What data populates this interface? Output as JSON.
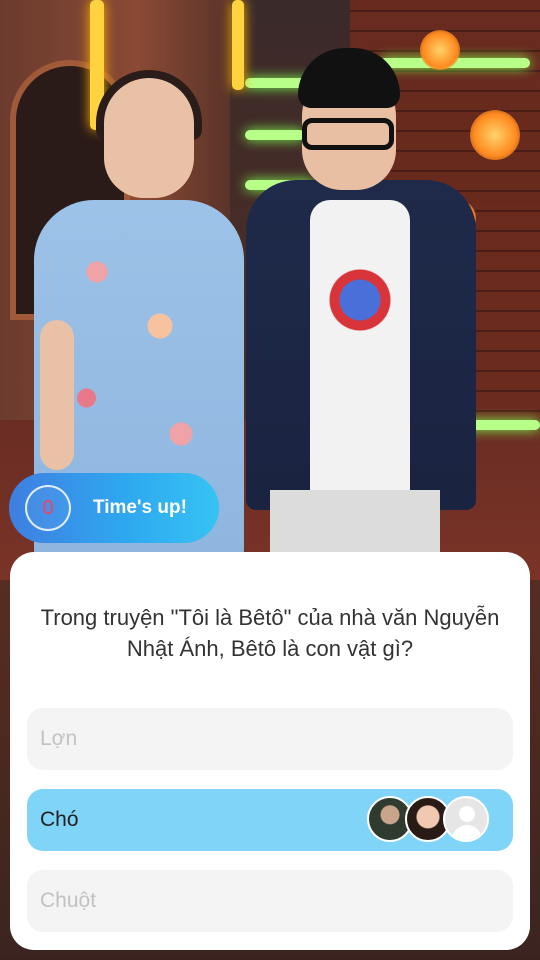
{
  "timer": {
    "count": "0",
    "status": "Time's up!"
  },
  "question": {
    "text": "Trong truyện \"Tôi là Bêtô\" của nhà văn Nguyễn Nhật Ánh, Bêtô là con vật gì?"
  },
  "answers": [
    {
      "label": "Lợn",
      "state": "default"
    },
    {
      "label": "Chó",
      "state": "correct",
      "avatar_count": 3
    },
    {
      "label": "Chuột",
      "state": "default"
    }
  ],
  "colors": {
    "correct_answer": "#80d4f8",
    "answer_default": "#f4f4f4",
    "timer_gradient_start": "#3f7fe0",
    "timer_gradient_end": "#36c3f3",
    "timer_count": "#ff3b5b"
  }
}
